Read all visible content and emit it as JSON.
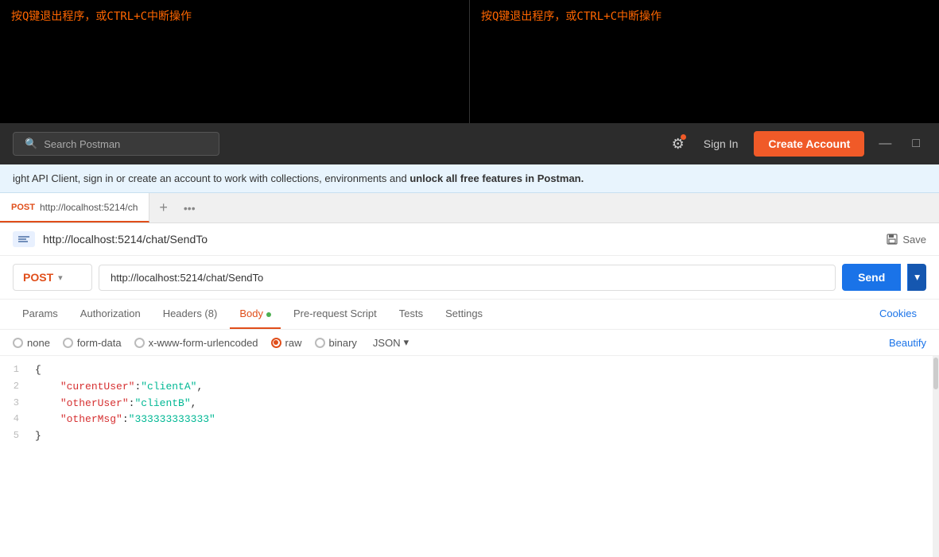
{
  "terminal": {
    "pane1_text": "按Q键退出程序，或CTRL+C中断操作",
    "pane2_text": "按Q键退出程序，或CTRL+C中断操作"
  },
  "header": {
    "search_placeholder": "Search Postman",
    "signin_label": "Sign In",
    "create_account_label": "Create Account",
    "minimize_symbol": "—",
    "maximize_symbol": "□"
  },
  "banner": {
    "text_prefix": "ight API Client, sign in or create an account to work with collections, environments and ",
    "text_bold": "unlock all free features in Postman.",
    "text_suffix": ""
  },
  "tab": {
    "method": "POST",
    "url": "http://localhost:5214/ch",
    "add_symbol": "+",
    "more_symbol": "•••"
  },
  "request": {
    "icon_text": "~~",
    "title_url": "http://localhost:5214/chat/SendTo",
    "save_label": "Save",
    "method": "POST",
    "url_value": "http://localhost:5214/chat/SendTo",
    "send_label": "Send",
    "chevron_down": "▾"
  },
  "tabs": {
    "params_label": "Params",
    "auth_label": "Authorization",
    "headers_label": "Headers (8)",
    "body_label": "Body",
    "prerequest_label": "Pre-request Script",
    "tests_label": "Tests",
    "settings_label": "Settings",
    "cookies_label": "Cookies"
  },
  "body_options": {
    "none_label": "none",
    "form_data_label": "form-data",
    "urlencoded_label": "x-www-form-urlencoded",
    "raw_label": "raw",
    "binary_label": "binary",
    "json_label": "JSON",
    "beautify_label": "Beautify"
  },
  "code": {
    "lines": [
      {
        "num": "1",
        "content": "{"
      },
      {
        "num": "2",
        "content": "    \"curentUser\":\"clientA\","
      },
      {
        "num": "3",
        "content": "    \"otherUser\":\"clientB\","
      },
      {
        "num": "4",
        "content": "    \"otherMsg\":\"333333333333\""
      },
      {
        "num": "5",
        "content": "}"
      }
    ]
  },
  "colors": {
    "accent": "#e04e1a",
    "blue": "#1a73e8",
    "green": "#4caf50"
  }
}
